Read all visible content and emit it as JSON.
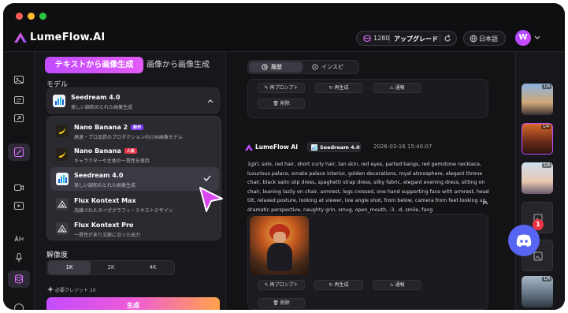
{
  "window": {
    "controls": [
      "close",
      "minimize",
      "maximize"
    ]
  },
  "appbar": {
    "brand": "LumeFlow.AI",
    "credits": "1280",
    "upgrade_label": "アップグレード",
    "language": "日本語",
    "avatar_initial": "W"
  },
  "panel": {
    "tabs": {
      "active": "テキストから画像生成",
      "inactive": "画像から画像生成"
    },
    "model_label": "モデル",
    "selected_model": {
      "name": "Seedream 4.0",
      "desc": "美しい調和のとれた画像生成"
    },
    "models": [
      {
        "name": "Nano Banana 2",
        "badge": "新作",
        "desc": "高速・プロ品質のプロダクション向けAI画像モデル"
      },
      {
        "name": "Nano Banana",
        "badge": "人気",
        "desc": "キャラクターや主体の一貫性を保持"
      },
      {
        "name": "Seedream 4.0",
        "badge": "",
        "desc": "美しい調和のとれた画像生成"
      },
      {
        "name": "Flux Kontext Max",
        "badge": "",
        "desc": "洗練されたタイポグラフィ・テキストデザイン"
      },
      {
        "name": "Flux Kontext Pro",
        "badge": "",
        "desc": "一貫性があり文脈に沿った出力"
      }
    ],
    "resolution_label": "解像度",
    "resolutions": [
      "1K",
      "2K",
      "4K"
    ],
    "credits_needed": "必要クレジット 10",
    "generate_label": "生成"
  },
  "main": {
    "tabs": [
      "履歴",
      "インスピ"
    ],
    "actions": {
      "reprompt": "再プロンプト",
      "regenerate": "再生成",
      "report": "通報",
      "delete": "削除"
    },
    "entry": {
      "brand": "LumeFlow AI",
      "model": "Seedream 4.0",
      "timestamp": "2026-03-16 15:40:07",
      "prompt": "1girl, solo, red hair, short curly hair, tan skin, red eyes, parted bangs, red gemstone necklace, luxurious palace, ornate palace interior, golden decorations, royal atmosphere, elegant throne chair, black satin slip dress, spaghetti strap dress, silky fabric, elegant evening dress, sitting on chair, leaning lazily on chair, armrest, legs crossed, one hand supporting face with armrest, head tilt, relaxed posture, looking at viewer, low angle shot, from below, camera from feet looking up, dramatic perspective, naughty grin, smug, open_mouth, :3, :d, smile, fang"
    }
  },
  "thumbs": [
    {
      "label": "1/4",
      "state": "image"
    },
    {
      "label": "1/4",
      "state": "image"
    },
    {
      "label": "1/4",
      "state": "image"
    },
    {
      "label": "",
      "state": "broken"
    },
    {
      "label": "",
      "state": "broken"
    },
    {
      "label": "1/4",
      "state": "image"
    }
  ],
  "discord": {
    "notifications": "1"
  },
  "colors": {
    "accent": "#c24bff",
    "background": "#16161a",
    "discord": "#5865f2"
  }
}
